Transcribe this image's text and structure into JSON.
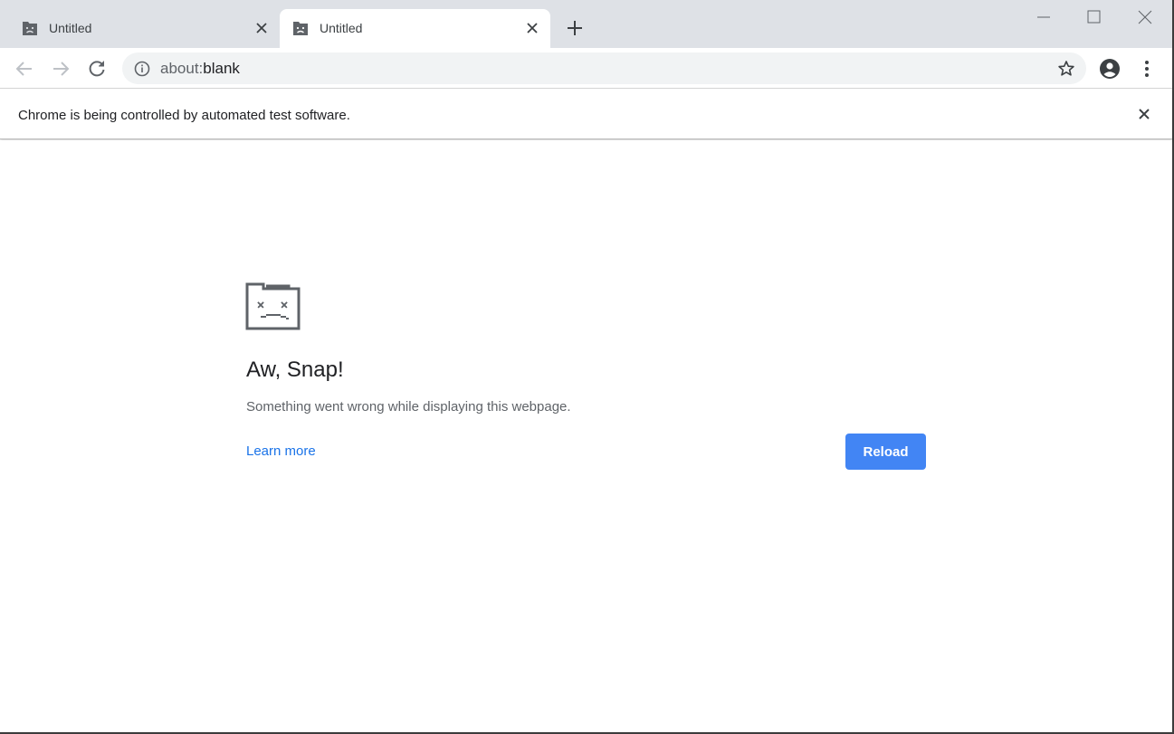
{
  "tabs": [
    {
      "title": "Untitled",
      "active": false
    },
    {
      "title": "Untitled",
      "active": true
    }
  ],
  "icons": {
    "tab_favicon": "sad-tab-icon",
    "tab_close": "close-icon",
    "new_tab": "plus-icon",
    "back": "arrow-left-icon",
    "forward": "arrow-right-icon",
    "reload": "reload-icon",
    "site_info": "info-icon",
    "bookmark": "star-icon",
    "profile": "account-icon",
    "menu": "kebab-menu-icon"
  },
  "omnibox": {
    "scheme": "about:",
    "path": "blank"
  },
  "infobar": {
    "message": "Chrome is being controlled by automated test software."
  },
  "error_page": {
    "headline": "Aw, Snap!",
    "description": "Something went wrong while displaying this webpage.",
    "learn_more": "Learn more",
    "reload_button": "Reload"
  },
  "colors": {
    "tabstrip_bg": "#dee1e6",
    "omnibox_bg": "#f1f3f4",
    "accent": "#4285f4",
    "link": "#1a73e8"
  }
}
